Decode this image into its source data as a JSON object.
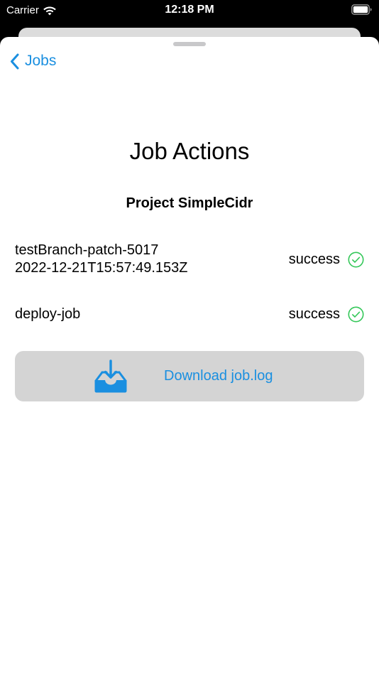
{
  "status_bar": {
    "carrier": "Carrier",
    "time": "12:18 PM",
    "icons": [
      "wifi-icon",
      "battery-icon"
    ]
  },
  "nav": {
    "back_label": "Jobs",
    "back_icon": "chevron-left-icon"
  },
  "page": {
    "title": "Job Actions",
    "project": "Project SimpleCidr"
  },
  "jobs": [
    {
      "name_line1": "testBranch-patch-5017",
      "name_line2": "2022-12-21T15:57:49.153Z",
      "status": "success",
      "status_icon": "check-circle-icon"
    },
    {
      "name_line1": "deploy-job",
      "status": "success",
      "status_icon": "check-circle-icon"
    }
  ],
  "download": {
    "label": "Download job.log",
    "icon": "tray-download-icon"
  },
  "colors": {
    "accent": "#1a8fe0",
    "success": "#34c759",
    "button_bg": "#d4d4d4"
  }
}
